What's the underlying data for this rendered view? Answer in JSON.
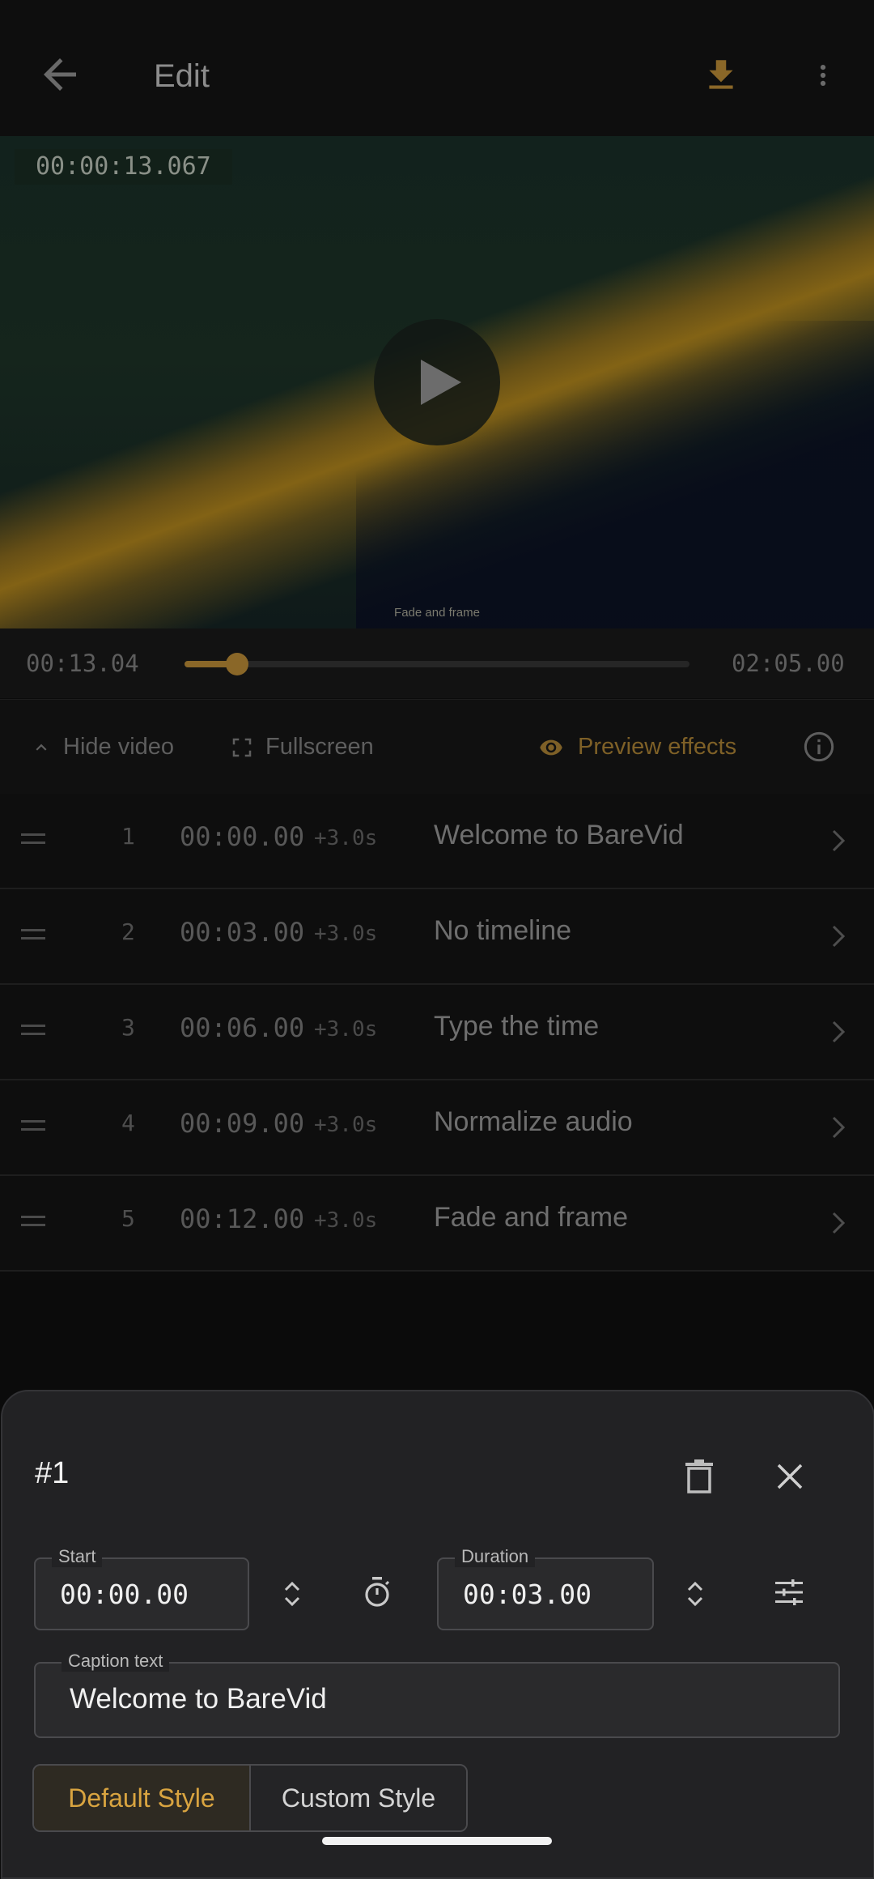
{
  "appbar": {
    "title": "Edit",
    "back_icon": "arrow-left-icon",
    "download_icon": "download-icon",
    "more_icon": "more-vertical-icon",
    "accent": "#8a6728"
  },
  "video": {
    "timecode": "00:00:13.067",
    "caption_preview": "Fade and frame",
    "play_icon": "play-icon"
  },
  "seek": {
    "current": "00:13.04",
    "total": "02:05.00",
    "progress_fraction": 0.104
  },
  "controls": {
    "hide_video": "Hide video",
    "fullscreen": "Fullscreen",
    "preview_effects": "Preview effects",
    "info_icon": "info-icon"
  },
  "captions": [
    {
      "index": "1",
      "start": "00:00.00",
      "duration": "+3.0s",
      "text": "Welcome to BareVid"
    },
    {
      "index": "2",
      "start": "00:03.00",
      "duration": "+3.0s",
      "text": "No timeline"
    },
    {
      "index": "3",
      "start": "00:06.00",
      "duration": "+3.0s",
      "text": "Type the time"
    },
    {
      "index": "4",
      "start": "00:09.00",
      "duration": "+3.0s",
      "text": "Normalize audio"
    },
    {
      "index": "5",
      "start": "00:12.00",
      "duration": "+3.0s",
      "text": "Fade and frame"
    }
  ],
  "sheet": {
    "number": "#1",
    "start_label": "Start",
    "start_value": "00:00.00",
    "duration_label": "Duration",
    "duration_value": "00:03.00",
    "caption_label": "Caption text",
    "caption_value": "Welcome to BareVid",
    "default_style": "Default Style",
    "custom_style": "Custom Style",
    "accent": "#d9a440"
  }
}
